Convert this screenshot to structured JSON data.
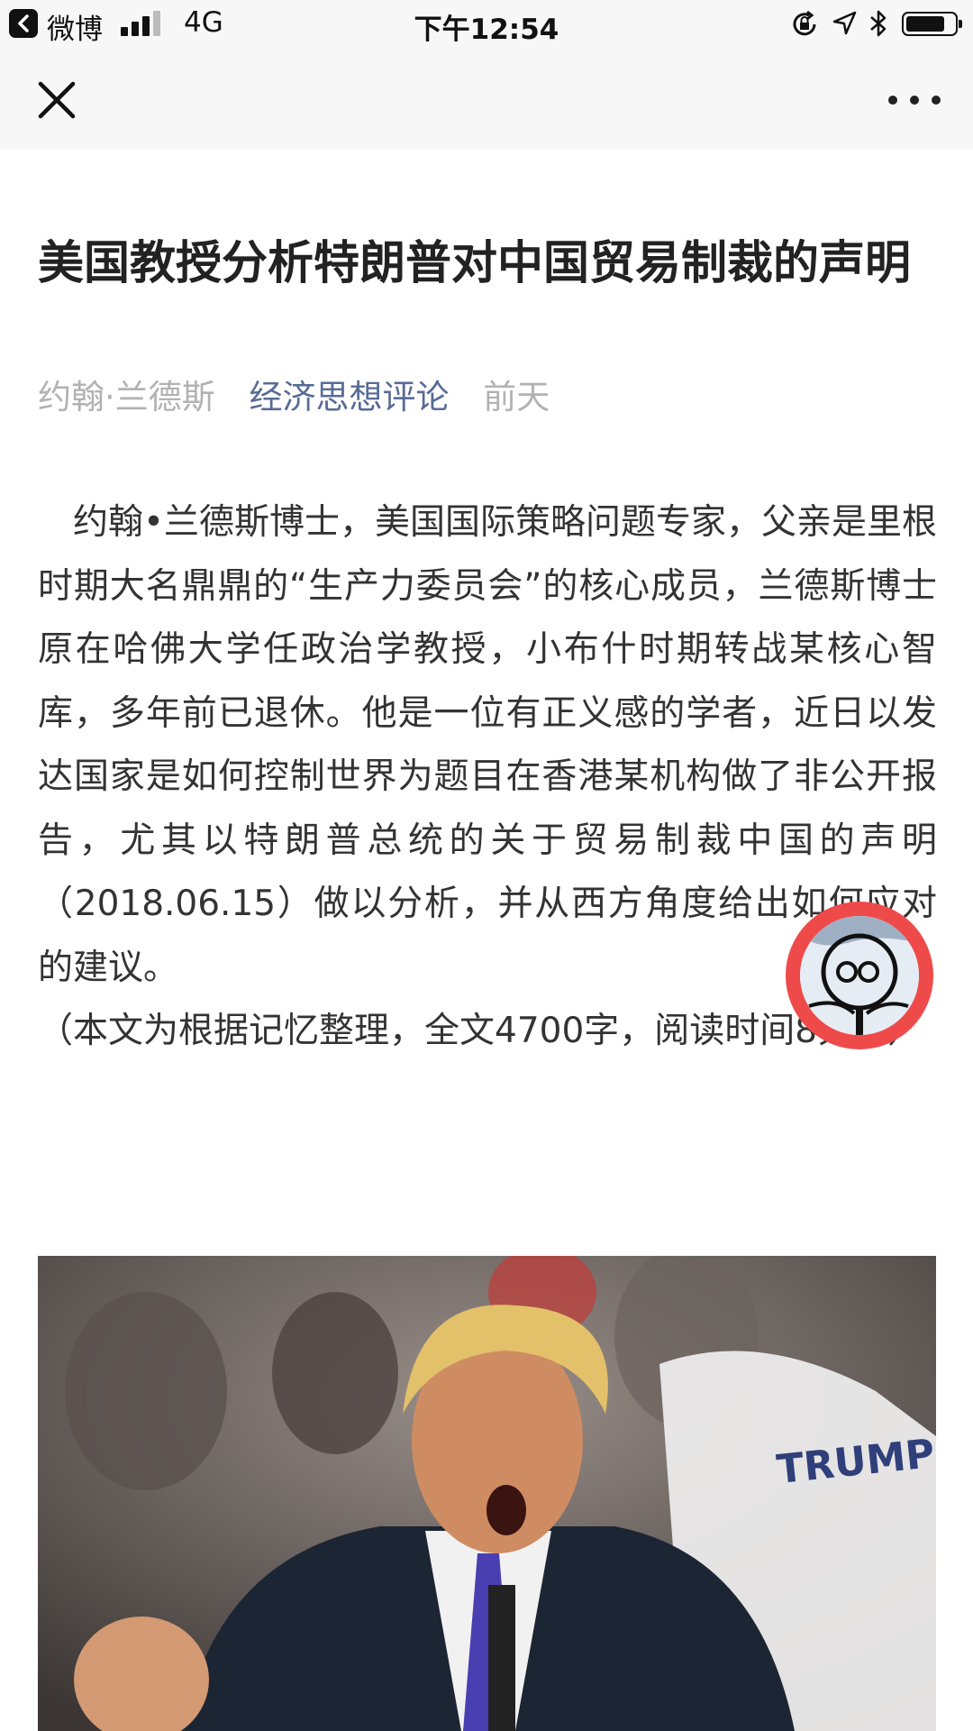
{
  "status_bar": {
    "back_app": "微博",
    "network": "4G",
    "time": "下午12:54",
    "signal_bars": 3
  },
  "nav": {
    "close_icon": "close-icon",
    "more_icon": "more-icon"
  },
  "article": {
    "title": "美国教授分析特朗普对中国贸易制裁的声明",
    "author": "约翰·兰德斯",
    "account": "经济思想评论",
    "time": "前天",
    "paragraph_1": "　约翰•兰德斯博士，美国国际策略问题专家，父亲是里根时期大名鼎鼎的“生产力委员会”的核心成员，兰德斯博士原在哈佛大学任政治学教授，小布什时期转战某核心智库，多年前已退休。他是一位有正义感的学者，近日以发达国家是如何控制世界为题目在香港某机构做了非公开报告，尤其以特朗普总统的关于贸易制裁中国的声明（2018.06.15）做以分析，并从西方角度给出如何应对的建议。",
    "paragraph_2": "（本文为根据记忆整理，全文4700字，阅读时间8分钟）",
    "image_sign_text": "TRUMP"
  },
  "colors": {
    "account_link": "#576b95",
    "meta_gray": "#b2b2b2",
    "float_ring": "#ef4a4a"
  }
}
